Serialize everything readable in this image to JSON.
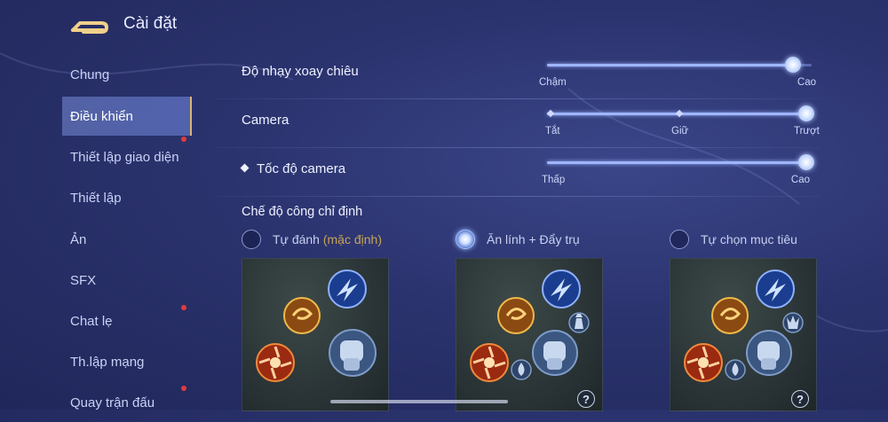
{
  "header": {
    "title": "Cài đặt"
  },
  "sidebar": {
    "items": [
      {
        "label": "Chung",
        "active": false,
        "badge": false
      },
      {
        "label": "Điều khiển",
        "active": true,
        "badge": false
      },
      {
        "label": "Thiết lập giao diện",
        "active": false,
        "badge": true
      },
      {
        "label": "Thiết lập",
        "active": false,
        "badge": false
      },
      {
        "label": "Ản",
        "active": false,
        "badge": false
      },
      {
        "label": "SFX",
        "active": false,
        "badge": false
      },
      {
        "label": "Chat lẹ",
        "active": false,
        "badge": true
      },
      {
        "label": "Th.lập mạng",
        "active": false,
        "badge": false
      },
      {
        "label": "Quay trận đấu",
        "active": false,
        "badge": true
      }
    ]
  },
  "settings": {
    "skill_sensitivity": {
      "label": "Độ nhạy xoay chiêu",
      "value": 0.93,
      "min_label": "Chậm",
      "max_label": "Cao"
    },
    "camera": {
      "label": "Camera",
      "selected": "Trượt",
      "stops": [
        "Tắt",
        "Giữ",
        "Trượt"
      ]
    },
    "camera_speed": {
      "label": "Tốc độ camera",
      "value": 1.0,
      "min_label": "Thấp",
      "max_label": "Cao"
    }
  },
  "attack_mode": {
    "title": "Chế độ công chỉ định",
    "options": [
      {
        "label": "Tự đánh",
        "note": "(mặc định)",
        "selected": false,
        "icons": [
          "skill-fire-icon",
          "skill-wind-icon",
          "skill-lightning-icon",
          "fist-attack-icon"
        ]
      },
      {
        "label": "Ăn lính + Đẩy trụ",
        "note": "",
        "selected": true,
        "icons": [
          "skill-fire-icon",
          "skill-wind-icon",
          "skill-lightning-icon",
          "fist-attack-icon",
          "tower-icon",
          "minion-icon",
          "help-icon"
        ]
      },
      {
        "label": "Tự chọn mục tiêu",
        "note": "",
        "selected": false,
        "icons": [
          "skill-fire-icon",
          "skill-wind-icon",
          "skill-lightning-icon",
          "fist-attack-icon",
          "hero-target-icon",
          "minion-icon",
          "help-icon"
        ]
      }
    ],
    "help_symbol": "?"
  },
  "colors": {
    "accent": "#9fb6ff",
    "active_border": "#d9b673",
    "badge": "#e23a3a",
    "note": "#c9a455"
  }
}
